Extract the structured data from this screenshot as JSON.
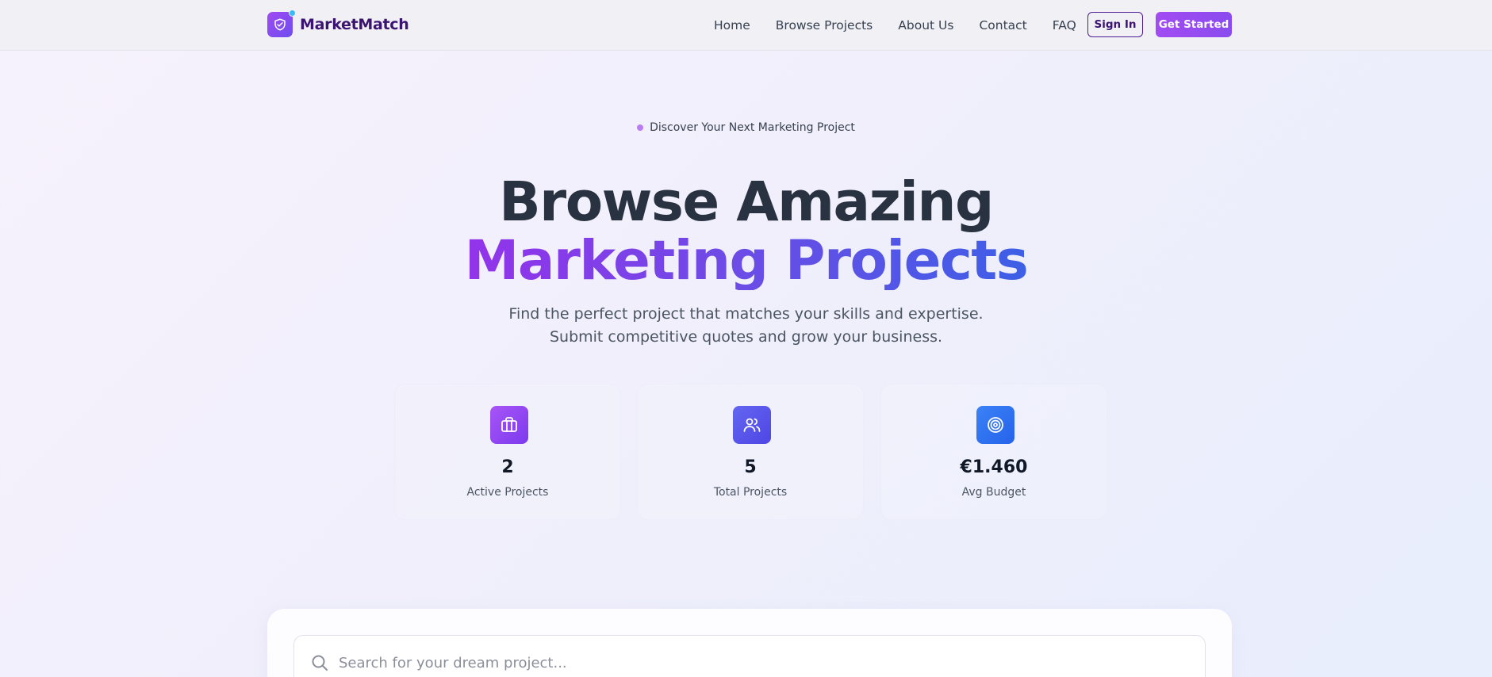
{
  "brand": {
    "name": "MarketMatch",
    "logo_icon": "handshake-shield-icon"
  },
  "nav": {
    "links": [
      "Home",
      "Browse Projects",
      "About Us",
      "Contact",
      "FAQ"
    ],
    "sign_in": "Sign In",
    "get_started": "Get Started"
  },
  "hero": {
    "badge": "Discover Your Next Marketing Project",
    "title_line1": "Browse Amazing",
    "title_line2": "Marketing Projects",
    "subtitle": "Find the perfect project that matches your skills and expertise. Submit competitive quotes and grow your business."
  },
  "stats": [
    {
      "value": "2",
      "label": "Active Projects",
      "icon": "briefcase-icon",
      "color_from": "#a855f7",
      "color_to": "#7c3aed"
    },
    {
      "value": "5",
      "label": "Total Projects",
      "icon": "users-icon",
      "color_from": "#6366f1",
      "color_to": "#4f46e5"
    },
    {
      "value": "€1.460",
      "label": "Avg Budget",
      "icon": "target-icon",
      "color_from": "#3b82f6",
      "color_to": "#2563eb"
    }
  ],
  "search": {
    "placeholder": "Search for your dream project..."
  },
  "colors": {
    "brand": "#3b1471",
    "accent": "#9333ea",
    "accent_blue": "#3d5fe6"
  }
}
